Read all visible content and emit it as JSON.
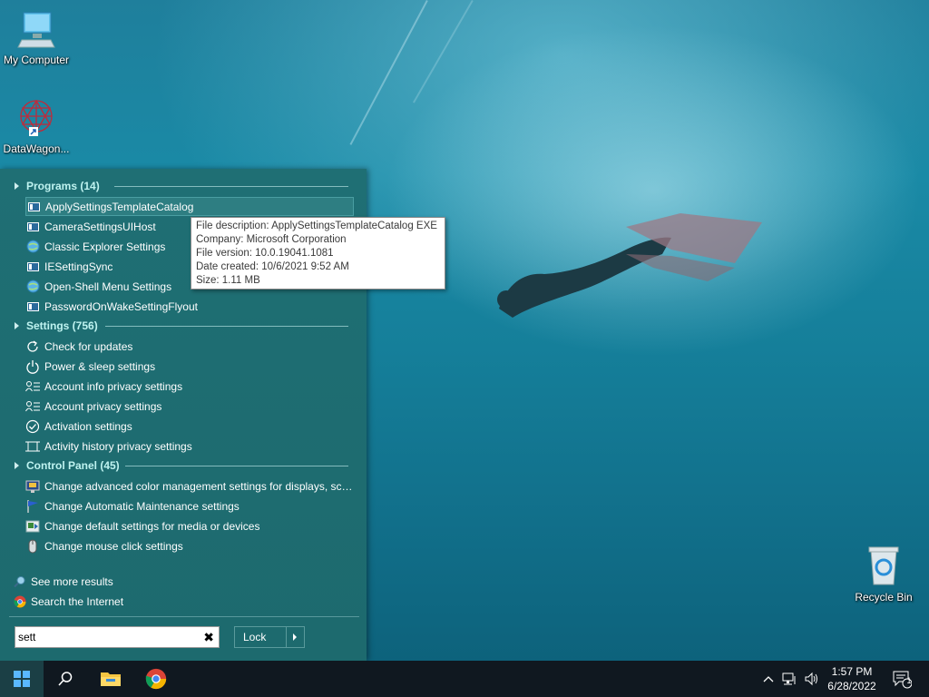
{
  "desktop": {
    "icons": [
      {
        "label": "My Computer",
        "icon": "computer-icon"
      },
      {
        "label": "DataWagon...",
        "icon": "datawagon-icon"
      },
      {
        "label": "Recycle Bin",
        "icon": "recycle-bin-icon"
      }
    ]
  },
  "start_menu": {
    "sections": {
      "programs": {
        "title": "Programs (14)",
        "items": [
          {
            "label": "ApplySettingsTemplateCatalog",
            "icon": "app-window-icon"
          },
          {
            "label": "CameraSettingsUIHost",
            "icon": "app-window-icon"
          },
          {
            "label": "Classic Explorer Settings",
            "icon": "globe-icon"
          },
          {
            "label": "IESettingSync",
            "icon": "app-window-icon"
          },
          {
            "label": "Open-Shell Menu Settings",
            "icon": "globe-icon"
          },
          {
            "label": "PasswordOnWakeSettingFlyout",
            "icon": "app-window-icon"
          }
        ]
      },
      "settings": {
        "title": "Settings (756)",
        "items": [
          {
            "label": "Check for updates",
            "icon": "refresh-icon"
          },
          {
            "label": "Power & sleep settings",
            "icon": "power-icon"
          },
          {
            "label": "Account info privacy settings",
            "icon": "account-list-icon"
          },
          {
            "label": "Account privacy settings",
            "icon": "account-list-icon"
          },
          {
            "label": "Activation settings",
            "icon": "check-circle-icon"
          },
          {
            "label": "Activity history privacy settings",
            "icon": "activity-history-icon"
          }
        ]
      },
      "control_panel": {
        "title": "Control Panel (45)",
        "items": [
          {
            "label": "Change advanced color management settings for displays, sca...",
            "icon": "color-management-icon"
          },
          {
            "label": "Change Automatic Maintenance settings",
            "icon": "flag-icon"
          },
          {
            "label": "Change default settings for media or devices",
            "icon": "autoplay-icon"
          },
          {
            "label": "Change mouse click settings",
            "icon": "mouse-icon"
          }
        ]
      }
    },
    "tooltip": {
      "lines": [
        "File description: ApplySettingsTemplateCatalog EXE",
        "Company: Microsoft Corporation",
        "File version: 10.0.19041.1081",
        "Date created: 10/6/2021 9:52 AM",
        "Size: 1.11 MB"
      ]
    },
    "bottom_links": {
      "see_more": "See more results",
      "search_internet": "Search the Internet"
    },
    "search": {
      "value": "sett"
    },
    "lock_label": "Lock"
  },
  "taskbar": {
    "clock_time": "1:57 PM",
    "clock_date": "6/28/2022",
    "notification_count": "1"
  },
  "colors": {
    "menu_bg": "#1f6f74",
    "section_header": "#bff3f0",
    "taskbar_bg": "#101820"
  }
}
